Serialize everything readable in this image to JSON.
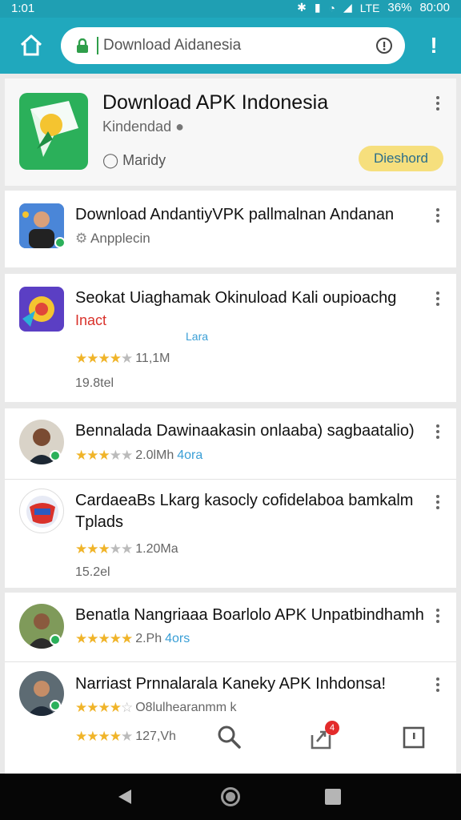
{
  "status_bar": {
    "time": "1:01",
    "battery": "36%",
    "clock": "80:00",
    "lte": "LTE"
  },
  "url_bar": {
    "url_text": "Download Aidanesia"
  },
  "featured": {
    "title": "Download APK Indonesia",
    "subtitle": "Kindendad",
    "meta": "Maridy",
    "button_label": "Dieshord"
  },
  "apps": [
    {
      "title": "Download AndantiyVPK pallmalnan Andanan",
      "meta": "Anpplecin"
    },
    {
      "title": "Seokat Uiaghamak Okinuload Kali oupioachg",
      "tag": "Inact",
      "label": "Lara",
      "rating_value": "11,1M",
      "size": "19.8tel"
    },
    {
      "title": "Bennalada Dawinaakasin onlaaba) sagbaatalio)",
      "rating_value": "2.0lMh",
      "extra": "4ora"
    },
    {
      "title": "CardaeaBs Lkarg kasocly cofidelaboa bamkalm",
      "title_line2": "Tplads",
      "rating_value": "1.20Ma",
      "size": "15.2el"
    },
    {
      "title": "Benatla Nangriaaa Boarlolo APK Unpatbindhamh",
      "rating_value": "2.Ph",
      "extra": "4ors"
    },
    {
      "title": "Narriast Prnnalarala Kaneky APK Inhdonsa!",
      "rating_value": "O8lulhearanmm k",
      "rating_value2": "127,Vh"
    }
  ],
  "bottom": {
    "notification_count": "4"
  },
  "colors": {
    "accent": "#20a8bd",
    "green": "#2bb05a",
    "button": "#f6df7d"
  },
  "icons": [
    "home-icon",
    "lock-icon",
    "info-icon",
    "alert-icon",
    "search-icon",
    "share-icon",
    "tab-icon",
    "back-icon",
    "home-circle-icon",
    "recent-icon"
  ]
}
